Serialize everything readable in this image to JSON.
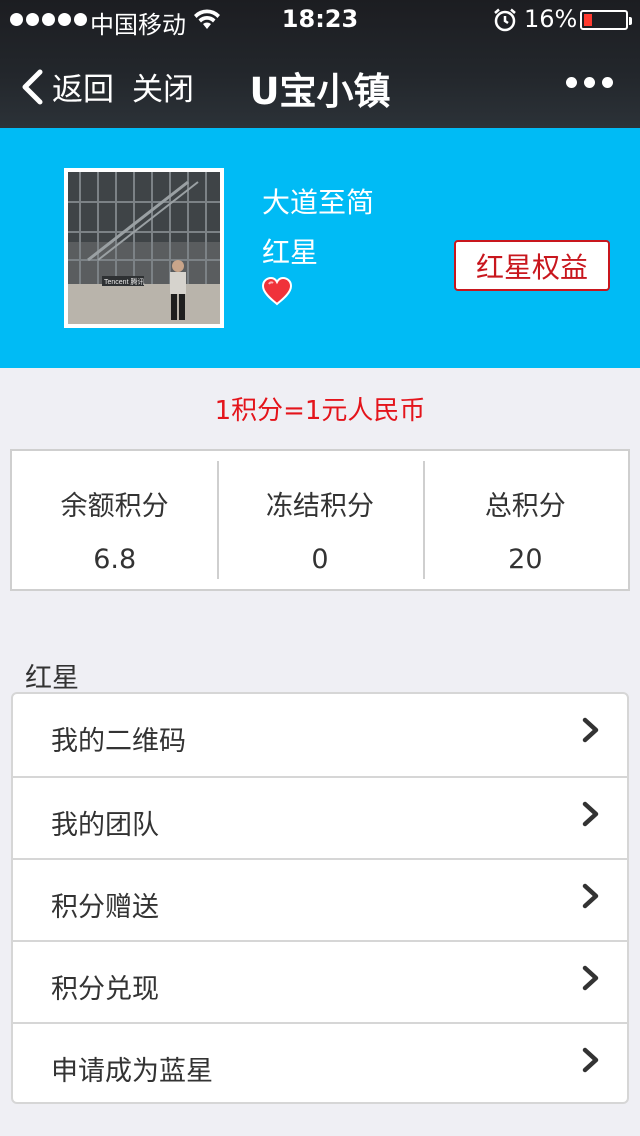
{
  "status_bar": {
    "carrier": "中国移动",
    "time": "18:23",
    "battery_percent": "16%"
  },
  "nav": {
    "back_label": "返回",
    "close_label": "关闭",
    "title": "U宝小镇"
  },
  "profile": {
    "nickname": "大道至简",
    "level": "红星",
    "rights_button": "红星权益",
    "avatar_sign_text": "Tencent 腾讯"
  },
  "rate_text": "1积分=1元人民币",
  "points": [
    {
      "label": "余额积分",
      "value": "6.8"
    },
    {
      "label": "冻结积分",
      "value": "0"
    },
    {
      "label": "总积分",
      "value": "20"
    }
  ],
  "section_title": "红星",
  "menu_items": [
    {
      "label": "我的二维码"
    },
    {
      "label": "我的团队"
    },
    {
      "label": "积分赠送"
    },
    {
      "label": "积分兑现"
    },
    {
      "label": "申请成为蓝星"
    }
  ],
  "colors": {
    "banner": "#00bbf5",
    "accent_red": "#e4141b",
    "button_red": "#c8161d",
    "page_bg": "#efeff4"
  }
}
